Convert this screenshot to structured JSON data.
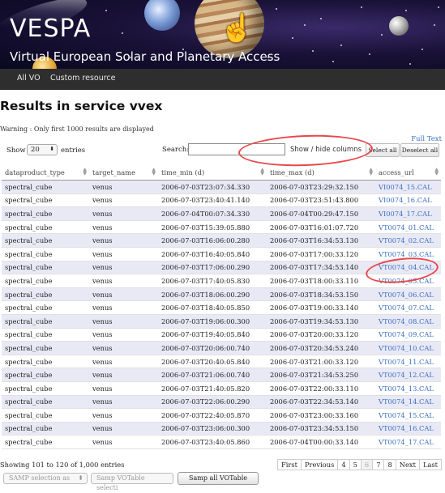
{
  "banner": {
    "title": "VESPA",
    "subtitle": "Virtual European Solar and Planetary Access"
  },
  "nav": {
    "items": [
      "All VO",
      "Custom resource"
    ]
  },
  "page": {
    "title": "Results in service vvex",
    "warning": "Warning : Only first 1000 results are displayed",
    "full_text_link": "Full Text"
  },
  "controls": {
    "show_label": "Show",
    "page_length": "20",
    "entries_label": "entries",
    "search_label": "Search:",
    "search_value": "",
    "colvis_button": "Show / hide columns",
    "select_all": "Select all",
    "deselect_all": "Deselect all"
  },
  "table": {
    "columns": [
      "dataproduct_type",
      "target_name",
      "time_min (d)",
      "time_max (d)",
      "access_url"
    ],
    "rows": [
      [
        "spectral_cube",
        "venus",
        "2006-07-03T23:07:34.330",
        "2006-07-03T23:29:32.150",
        "VI0074_15.CAL"
      ],
      [
        "spectral_cube",
        "venus",
        "2006-07-03T23:40:41.140",
        "2006-07-03T23:51:43.800",
        "VI0074_16.CAL"
      ],
      [
        "spectral_cube",
        "venus",
        "2006-07-04T00:07:34.330",
        "2006-07-04T00:29:47.150",
        "VI0074_17.CAL"
      ],
      [
        "spectral_cube",
        "venus",
        "2006-07-03T15:39:05.880",
        "2006-07-03T16:01:07.720",
        "VT0074_01.CAL"
      ],
      [
        "spectral_cube",
        "venus",
        "2006-07-03T16:06:00.280",
        "2006-07-03T16:34:53.130",
        "VT0074_02.CAL"
      ],
      [
        "spectral_cube",
        "venus",
        "2006-07-03T16:40:05.840",
        "2006-07-03T17:00:33.120",
        "VT0074_03.CAL"
      ],
      [
        "spectral_cube",
        "venus",
        "2006-07-03T17:06:00.290",
        "2006-07-03T17:34:53.140",
        "VT0074_04.CAL"
      ],
      [
        "spectral_cube",
        "venus",
        "2006-07-03T17:40:05.830",
        "2006-07-03T18:00:33.110",
        "VT0074_05.CAL"
      ],
      [
        "spectral_cube",
        "venus",
        "2006-07-03T18:06:00.290",
        "2006-07-03T18:34:53.150",
        "VT0074_06.CAL"
      ],
      [
        "spectral_cube",
        "venus",
        "2006-07-03T18:40:05.850",
        "2006-07-03T19:00:33.140",
        "VT0074_07.CAL"
      ],
      [
        "spectral_cube",
        "venus",
        "2006-07-03T19:06:00.300",
        "2006-07-03T19:34:53.130",
        "VT0074_08.CAL"
      ],
      [
        "spectral_cube",
        "venus",
        "2006-07-03T19:40:05.840",
        "2006-07-03T20:00:33.120",
        "VT0074_09.CAL"
      ],
      [
        "spectral_cube",
        "venus",
        "2006-07-03T20:06:00.740",
        "2006-07-03T20:34:53.240",
        "VT0074_10.CAL"
      ],
      [
        "spectral_cube",
        "venus",
        "2006-07-03T20:40:05.840",
        "2006-07-03T21:00:33.120",
        "VT0074_11.CAL"
      ],
      [
        "spectral_cube",
        "venus",
        "2006-07-03T21:06:00.740",
        "2006-07-03T21:34:53.250",
        "VT0074_12.CAL"
      ],
      [
        "spectral_cube",
        "venus",
        "2006-07-03T21:40:05.820",
        "2006-07-03T22:00:33.110",
        "VT0074_13.CAL"
      ],
      [
        "spectral_cube",
        "venus",
        "2006-07-03T22:06:00.290",
        "2006-07-03T22:34:53.140",
        "VT0074_14.CAL"
      ],
      [
        "spectral_cube",
        "venus",
        "2006-07-03T22:40:05.870",
        "2006-07-03T23:00:33.160",
        "VT0074_15.CAL"
      ],
      [
        "spectral_cube",
        "venus",
        "2006-07-03T23:06:00.300",
        "2006-07-03T23:34:53.150",
        "VT0074_16.CAL"
      ],
      [
        "spectral_cube",
        "venus",
        "2006-07-03T23:40:05.860",
        "2006-07-04T00:00:33.140",
        "VT0074_17.CAL"
      ]
    ]
  },
  "footer": {
    "info": "Showing 101 to 120 of 1,000 entries",
    "pager": [
      "First",
      "Previous",
      "4",
      "5",
      "6",
      "7",
      "8",
      "Next",
      "Last"
    ],
    "samp_selection_placeholder": "SAMP selection as",
    "samp_votable_placeholder": "Samp VOTable selecti",
    "samp_all_button": "Samp all VOTable"
  },
  "colors": {
    "link": "#3a6fbf",
    "stripe": "#e9e9f6",
    "navbar": "#2e2e2e",
    "annotation": "#e8474a"
  }
}
